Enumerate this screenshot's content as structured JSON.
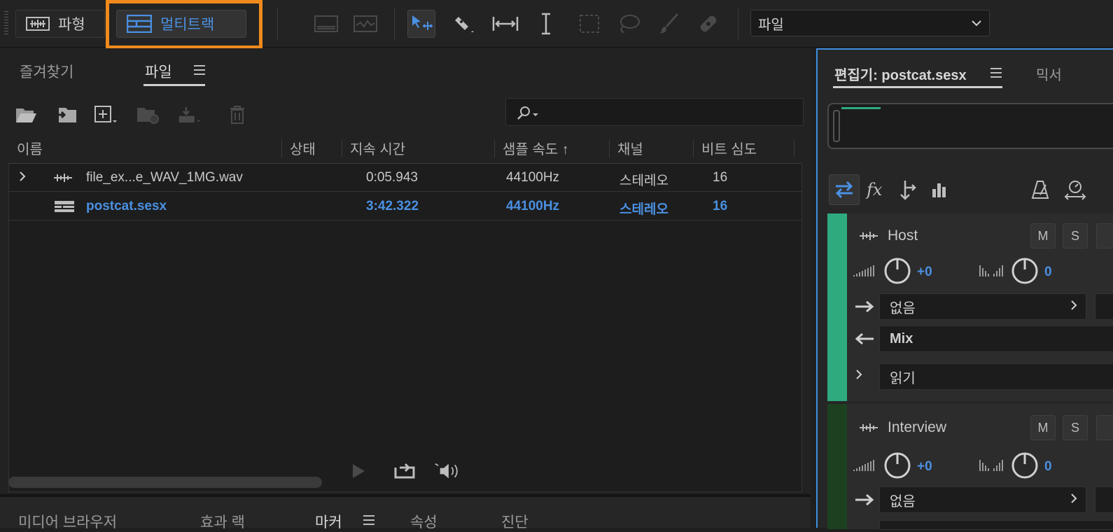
{
  "toolbar": {
    "mode_waveform": "파형",
    "mode_multitrack": "멀티트랙",
    "workspace": "파일"
  },
  "files_panel": {
    "tabs": [
      "즐겨찾기",
      "파일"
    ],
    "columns": [
      "이름",
      "상태",
      "지속 시간",
      "샘플 속도",
      "채널",
      "비트 심도"
    ],
    "sort_indicator": "↑",
    "rows": [
      {
        "name": "file_ex...e_WAV_1MG.wav",
        "status": "",
        "duration": "0:05.943",
        "sample_rate": "44100Hz",
        "channel": "스테레오",
        "bit_depth": "16"
      },
      {
        "name": "postcat.sesx",
        "status": "",
        "duration": "3:42.322",
        "sample_rate": "44100Hz",
        "channel": "스테레오",
        "bit_depth": "16"
      }
    ]
  },
  "bottom_panel": {
    "tabs": [
      "미디어 브라우저",
      "효과 랙",
      "마커",
      "속성",
      "진단"
    ]
  },
  "editor_panel": {
    "tabs": [
      "편집기: postcat.sesx",
      "믹서"
    ],
    "tracks": [
      {
        "name": "Host",
        "volume": "+0",
        "pan": "0",
        "input": "없음",
        "output": "Mix",
        "automation": "읽기",
        "color": "#2eaa7f"
      },
      {
        "name": "Interview",
        "volume": "+0",
        "pan": "0",
        "input": "없음",
        "color": "#1d4020"
      }
    ]
  },
  "colors": {
    "accent": "#4a90e2",
    "highlight": "#f08a1c"
  }
}
